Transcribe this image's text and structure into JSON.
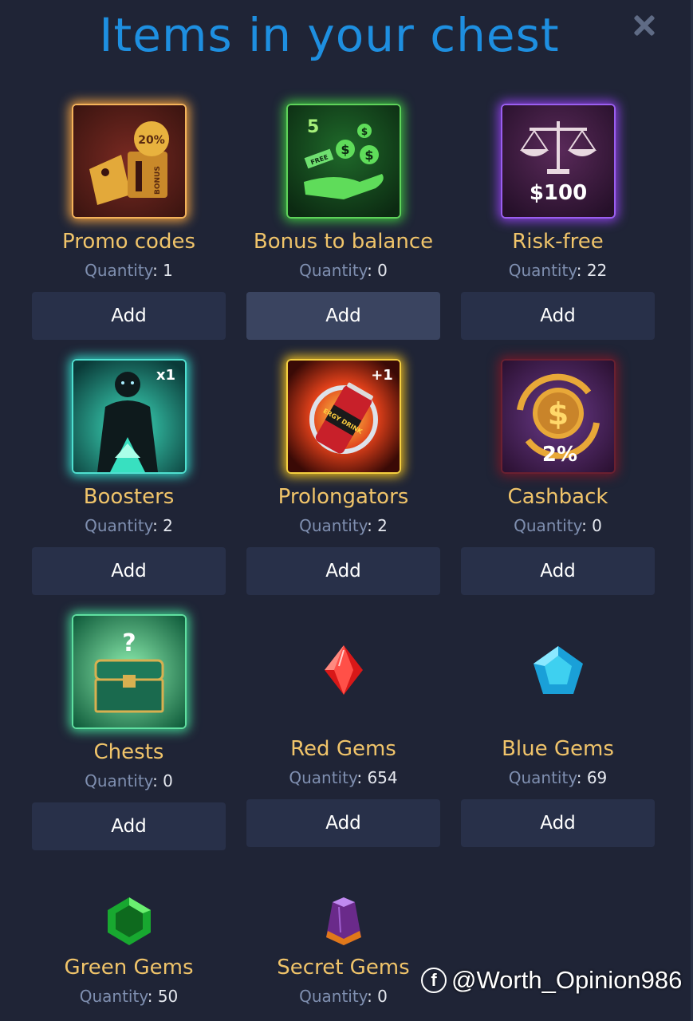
{
  "header": {
    "title": "Items in your chest"
  },
  "qty_label": "Quantity",
  "items": [
    {
      "name": "Promo codes",
      "quantity": ": 1",
      "add": "Add",
      "badge": "20%",
      "side": "BONUS"
    },
    {
      "name": "Bonus to balance",
      "quantity": ": 0",
      "add": "Add",
      "badge": "5",
      "side": "FREE"
    },
    {
      "name": "Risk-free",
      "quantity": ": 22",
      "add": "Add",
      "badge": "$100"
    },
    {
      "name": "Boosters",
      "quantity": ": 2",
      "add": "Add",
      "badge": "x1"
    },
    {
      "name": "Prolongators",
      "quantity": ": 2",
      "add": "Add",
      "badge": "+1",
      "side": "ERGY DRINK"
    },
    {
      "name": "Cashback",
      "quantity": ": 0",
      "add": "Add",
      "badge": "2%"
    },
    {
      "name": "Chests",
      "quantity": ": 0",
      "add": "Add",
      "badge": "?"
    },
    {
      "name": "Red Gems",
      "quantity": ": 654",
      "add": "Add"
    },
    {
      "name": "Blue Gems",
      "quantity": ": 69",
      "add": "Add"
    },
    {
      "name": "Green Gems",
      "quantity": ": 50"
    },
    {
      "name": "Secret Gems",
      "quantity": ": 0"
    }
  ],
  "watermark": {
    "logo": "f",
    "text": "@Worth_Opinion986"
  },
  "colors": {
    "accent": "#1e8fe0",
    "item_name": "#f0c46a",
    "button": "#283049",
    "button_hover": "#3a4460",
    "background": "#1f2436"
  }
}
